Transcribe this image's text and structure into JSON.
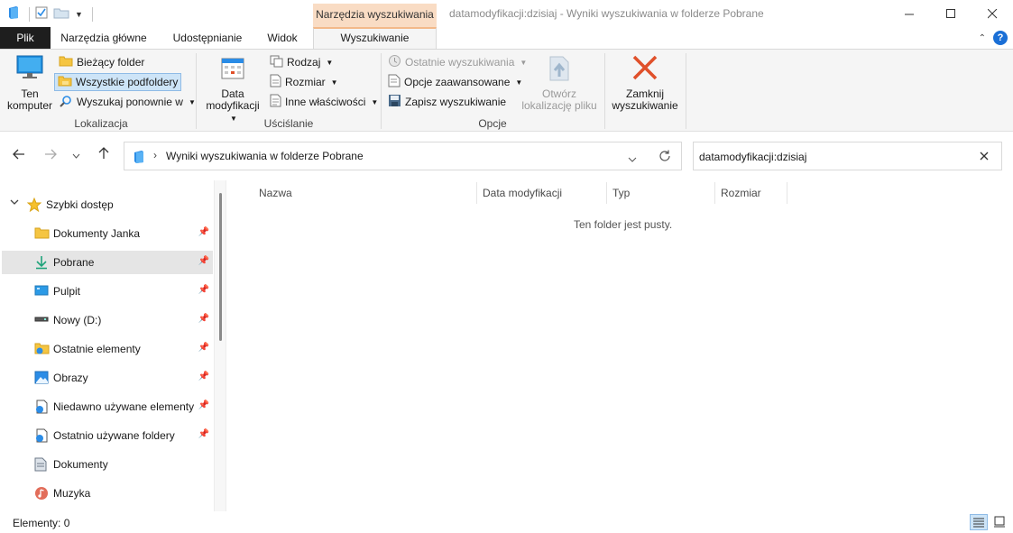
{
  "titlebar": {
    "context_tab": "Narzędzia wyszukiwania",
    "window_title": "datamodyfikacji:dzisiaj - Wyniki wyszukiwania w folderze Pobrane"
  },
  "tabs": {
    "file": "Plik",
    "home": "Narzędzia główne",
    "share": "Udostępnianie",
    "view": "Widok",
    "search": "Wyszukiwanie"
  },
  "ribbon": {
    "location": {
      "label": "Lokalizacja",
      "this_pc": [
        "Ten",
        "komputer"
      ],
      "current_folder": "Bieżący folder",
      "all_subfolders": "Wszystkie podfoldery",
      "search_again": "Wyszukaj ponownie w"
    },
    "refine": {
      "label": "Uściślanie",
      "date_modified": [
        "Data",
        "modyfikacji"
      ],
      "kind": "Rodzaj",
      "size": "Rozmiar",
      "other_props": "Inne właściwości"
    },
    "options": {
      "label": "Opcje",
      "recent_searches": "Ostatnie wyszukiwania",
      "advanced_options": "Opcje zaawansowane",
      "save_search": "Zapisz wyszukiwanie",
      "open_location": [
        "Otwórz",
        "lokalizację pliku"
      ]
    },
    "close": {
      "close_search": [
        "Zamknij",
        "wyszukiwanie"
      ]
    }
  },
  "address": {
    "path": "Wyniki wyszukiwania w folderze Pobrane"
  },
  "search": {
    "value": "datamodyfikacji:dzisiaj"
  },
  "navpane": {
    "quick_access": "Szybki dostęp",
    "items": [
      {
        "label": "Dokumenty Janka",
        "icon": "folder-icon"
      },
      {
        "label": "Pobrane",
        "icon": "download-icon"
      },
      {
        "label": "Pulpit",
        "icon": "desktop-icon"
      },
      {
        "label": "Nowy (D:)",
        "icon": "drive-icon"
      },
      {
        "label": "Ostatnie elementy",
        "icon": "recent-folder-icon"
      },
      {
        "label": "Obrazy",
        "icon": "pictures-icon"
      },
      {
        "label": "Niedawno używane elementy",
        "icon": "recent-items-icon"
      },
      {
        "label": "Ostatnio używane foldery",
        "icon": "recent-folders-icon"
      },
      {
        "label": "Dokumenty",
        "icon": "documents-icon"
      },
      {
        "label": "Muzyka",
        "icon": "music-icon"
      }
    ]
  },
  "content": {
    "columns": [
      "Nazwa",
      "Data modyfikacji",
      "Typ",
      "Rozmiar"
    ],
    "empty_text": "Ten folder jest pusty."
  },
  "status": {
    "count": "Elementy: 0"
  },
  "colors": {
    "accent_blue": "#1a6fd6",
    "context_tab_bg": "#f9dcc4",
    "close_red": "#e0502a",
    "folder_yellow": "#f5c542",
    "selection_bg": "#cde4f7"
  }
}
